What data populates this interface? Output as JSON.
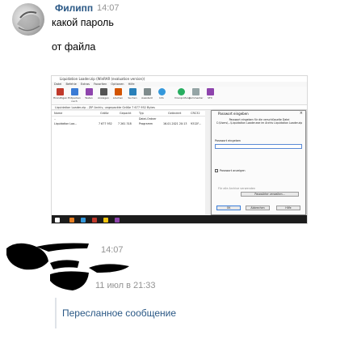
{
  "message": {
    "author": "Филипп",
    "time": "14:07",
    "lines": [
      "какой пароль",
      "от файла"
    ]
  },
  "screenshot": {
    "window_title": "Liquidation Loader.zip (WinRAR (evaluation version))",
    "menu": [
      "Datei",
      "Befehle",
      "Extras",
      "Favoriten",
      "Optionen",
      "Hilfe"
    ],
    "toolbar": [
      "Hinzufügen",
      "Entpacken nach",
      "Testen",
      "Anzeigen",
      "Löschen",
      "Suchen",
      "Assistent",
      "Info",
      "Virenprüfung",
      "Kommentar",
      "SFX"
    ],
    "path": "Liquidation Loader.zip - ZIP Archiv, ungepackte Größe 7 677 952 Bytes",
    "columns": [
      "Name",
      "Größe",
      "Gepackt",
      "Typ",
      "Geändert",
      "CRC32"
    ],
    "rows": [
      {
        "name": "..",
        "size": "",
        "packed": "",
        "type": "Datei-Ordner",
        "modified": "",
        "crc": ""
      },
      {
        "name": "Liquidation Loa...",
        "size": "7 677 952",
        "packed": "7 261 318",
        "type": "Programm",
        "modified": "16.01.2021 20:13",
        "crc": "9312F..."
      }
    ],
    "dialog": {
      "title": "Passwort eingeben",
      "text": "Passwort eingeben für die verschlüsselte Datei C:\\Users\\...\\Liquidation Loader.exe im Archiv Liquidation Loader.zip",
      "label": "Passwort eingeben",
      "checkbox": "Passwort anzeigen",
      "all_archives": "Für alle Archive verwenden",
      "manage": "Passwörter verwalten...",
      "ok": "OK",
      "cancel": "Abbrechen",
      "help": "Hilfe"
    }
  },
  "forwarded": {
    "time": "14:07",
    "date": "11 июл в 21:33",
    "label": "Пересланное сообщение"
  }
}
